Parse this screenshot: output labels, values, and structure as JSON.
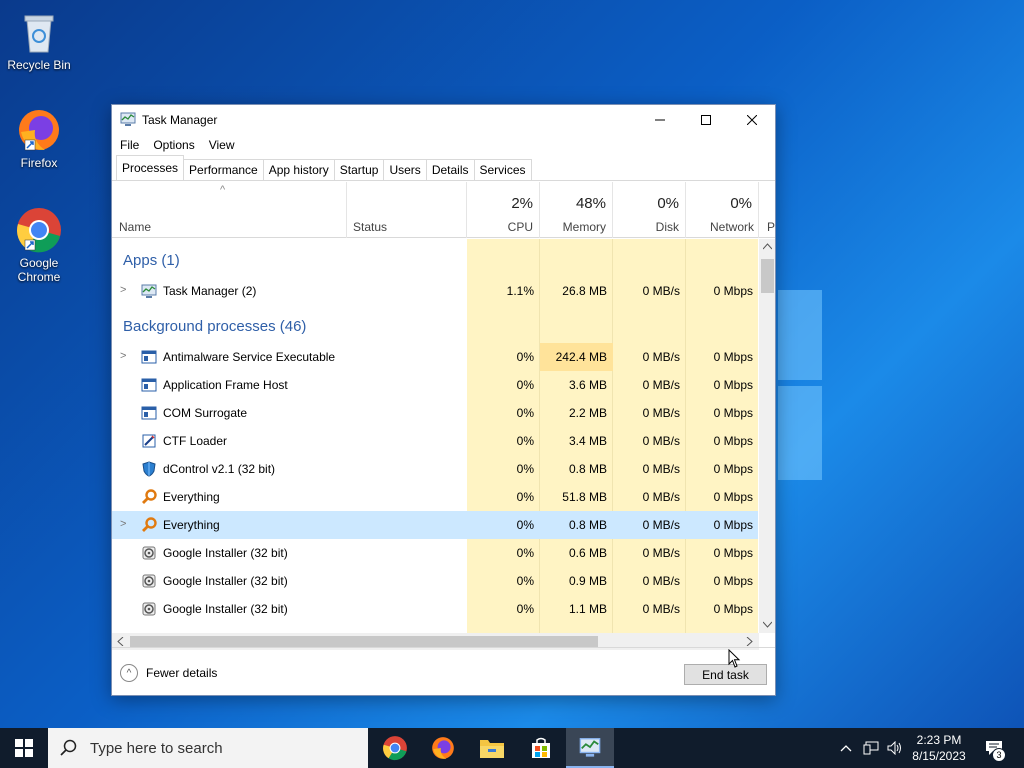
{
  "desktop": {
    "icons": [
      {
        "label": "Recycle Bin"
      },
      {
        "label": "Firefox"
      },
      {
        "label": "Google Chrome"
      }
    ]
  },
  "window": {
    "title": "Task Manager",
    "menu": [
      "File",
      "Options",
      "View"
    ],
    "tabs": [
      "Processes",
      "Performance",
      "App history",
      "Startup",
      "Users",
      "Details",
      "Services"
    ],
    "active_tab": "Processes"
  },
  "columns": {
    "name": "Name",
    "status": "Status",
    "cpu": {
      "pct": "2%",
      "label": "CPU"
    },
    "memory": {
      "pct": "48%",
      "label": "Memory"
    },
    "disk": {
      "pct": "0%",
      "label": "Disk"
    },
    "network": {
      "pct": "0%",
      "label": "Network"
    },
    "power_partial": "P"
  },
  "groups": {
    "apps": "Apps (1)",
    "background": "Background processes (46)"
  },
  "apps": [
    {
      "name": "Task Manager (2)",
      "cpu": "1.1%",
      "memory": "26.8 MB",
      "disk": "0 MB/s",
      "network": "0 Mbps",
      "expandable": true
    }
  ],
  "background": [
    {
      "name": "Antimalware Service Executable",
      "cpu": "0%",
      "memory": "242.4 MB",
      "disk": "0 MB/s",
      "network": "0 Mbps",
      "expandable": true
    },
    {
      "name": "Application Frame Host",
      "cpu": "0%",
      "memory": "3.6 MB",
      "disk": "0 MB/s",
      "network": "0 Mbps"
    },
    {
      "name": "COM Surrogate",
      "cpu": "0%",
      "memory": "2.2 MB",
      "disk": "0 MB/s",
      "network": "0 Mbps"
    },
    {
      "name": "CTF Loader",
      "cpu": "0%",
      "memory": "3.4 MB",
      "disk": "0 MB/s",
      "network": "0 Mbps"
    },
    {
      "name": "dControl v2.1 (32 bit)",
      "cpu": "0%",
      "memory": "0.8 MB",
      "disk": "0 MB/s",
      "network": "0 Mbps"
    },
    {
      "name": "Everything",
      "cpu": "0%",
      "memory": "51.8 MB",
      "disk": "0 MB/s",
      "network": "0 Mbps"
    },
    {
      "name": "Everything",
      "cpu": "0%",
      "memory": "0.8 MB",
      "disk": "0 MB/s",
      "network": "0 Mbps",
      "expandable": true,
      "selected": true
    },
    {
      "name": "Google Installer (32 bit)",
      "cpu": "0%",
      "memory": "0.6 MB",
      "disk": "0 MB/s",
      "network": "0 Mbps"
    },
    {
      "name": "Google Installer (32 bit)",
      "cpu": "0%",
      "memory": "0.9 MB",
      "disk": "0 MB/s",
      "network": "0 Mbps"
    },
    {
      "name": "Google Installer (32 bit)",
      "cpu": "0%",
      "memory": "1.1 MB",
      "disk": "0 MB/s",
      "network": "0 Mbps"
    }
  ],
  "footer": {
    "fewer_details": "Fewer details",
    "end_task": "End task"
  },
  "taskbar": {
    "search_placeholder": "Type here to search",
    "time": "2:23 PM",
    "date": "8/15/2023",
    "notification_count": "3"
  }
}
